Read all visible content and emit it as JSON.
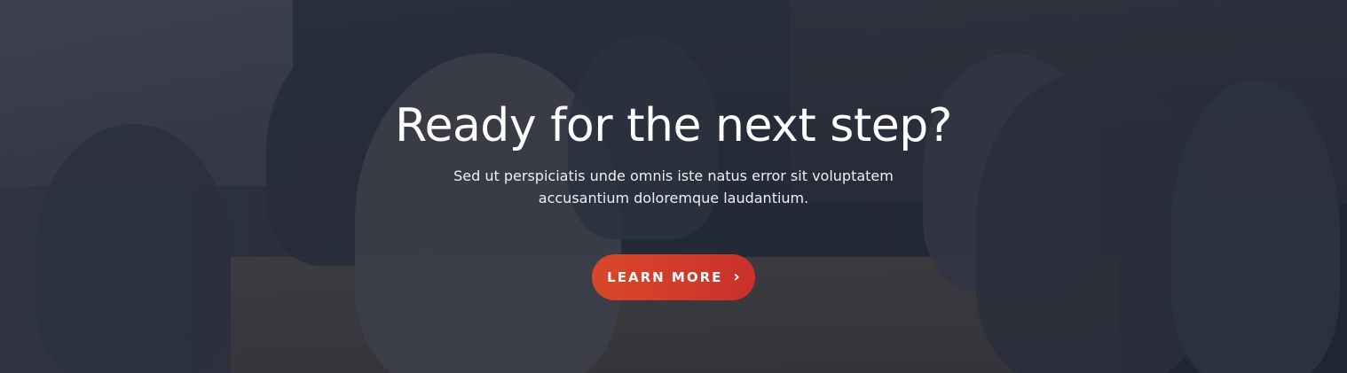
{
  "hero": {
    "title": "Ready for the next step?",
    "subtitle": "Sed ut perspiciatis unde omnis iste natus error sit voluptatem accusantium doloremque laudantium.",
    "cta_label": "LEARN MORE",
    "cta_icon": "chevron-right-icon",
    "accent_color": "#d9472a"
  }
}
